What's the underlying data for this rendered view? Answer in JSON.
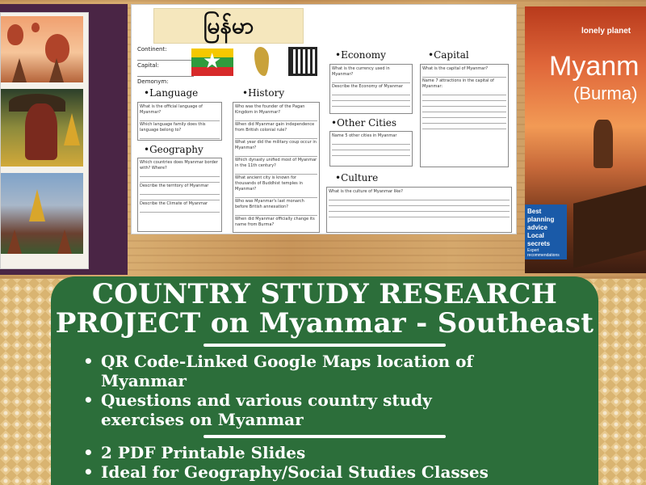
{
  "worksheet": {
    "burmese_title": "မြန်မာ",
    "id_fields": [
      "Continent:",
      "Capital:",
      "Demonym:"
    ],
    "sections": {
      "language": "Language",
      "history": "History",
      "geography": "Geography",
      "economy": "Economy",
      "capital": "Capital",
      "other_cities": "Other Cities",
      "culture": "Culture"
    },
    "questions": {
      "language": [
        "What is the official language of Myanmar?",
        "Which language family does this language belong to?"
      ],
      "history": [
        "Who was the founder of the Pagan Kingdom in Myanmar?",
        "When did Myanmar gain independence from British colonial rule?",
        "What year did the military coup occur in Myanmar?",
        "Which dynasty unified most of Myanmar in the 11th century?",
        "What ancient city is known for thousands of Buddhist temples in Myanmar?",
        "Who was Myanmar's last monarch before British annexation?",
        "When did Myanmar officially change its name from Burma?"
      ],
      "geography": [
        "Which countries does Myanmar border with? Where?",
        "Describe the territory of Myanmar",
        "Describe the Climate of Myanmar"
      ],
      "economy": [
        "What is the currency used in Myanmar?",
        "Describe the Economy of Myanmar"
      ],
      "capital": [
        "What is the capital of Myanmar?",
        "Name 7 attractions in the capital of Myanmar:"
      ],
      "other_cities": [
        "Name 5 other cities in Myanmar"
      ],
      "culture": [
        "What is the culture of Myanmar like?"
      ]
    }
  },
  "book": {
    "brand": "lonely planet",
    "title": "Myanm",
    "subtitle": "(Burma)",
    "badge_1": "Best planning advice",
    "badge_2": "Local secrets",
    "badge_3": "Expert recommendations"
  },
  "panel": {
    "title_line1": "COUNTRY STUDY RESEARCH",
    "title_line2": "PROJECT on Myanmar - Southeast",
    "bullets_a": [
      "QR Code-Linked Google Maps location of Myanmar",
      "Questions and various country study exercises on Myanmar"
    ],
    "bullets_b": [
      "2 PDF Printable Slides",
      "Ideal for Geography/Social Studies Classes"
    ]
  },
  "colors": {
    "panel_green": "#2c6e3a",
    "board_purple": "#4a2545",
    "cover_blue": "#1a5aa8"
  }
}
